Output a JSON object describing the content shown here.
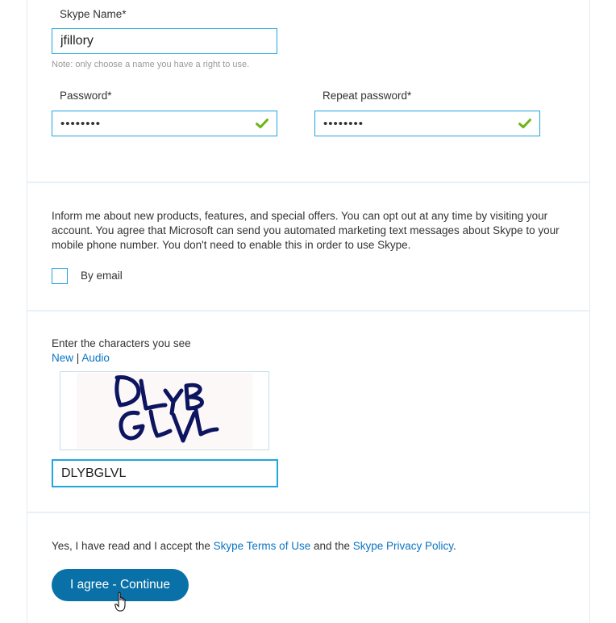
{
  "account": {
    "skype_name_label": "Skype Name*",
    "skype_name_value": "jfillory",
    "skype_name_note": "Note: only choose a name you have a right to use.",
    "password_label": "Password*",
    "password_value": "••••••••",
    "repeat_password_label": "Repeat password*",
    "repeat_password_value": "••••••••",
    "valid_icon": "checkmark-icon",
    "valid_color": "#6bb516"
  },
  "marketing": {
    "text": "Inform me about new products, features, and special offers. You can opt out at any time by visiting your account. You agree that Microsoft can send you automated marketing text messages about Skype to your mobile phone number. You don't need to enable this in order to use Skype.",
    "by_email_label": "By email",
    "by_email_checked": false
  },
  "captcha": {
    "prompt": "Enter the characters you see",
    "new_link": "New",
    "separator": "|",
    "audio_link": "Audio",
    "image_text": "DLYBGLVL",
    "input_value": "DLYBGLVL"
  },
  "terms": {
    "prefix": "Yes, I have read and I accept the ",
    "terms_link": "Skype Terms of Use",
    "middle": " and the ",
    "privacy_link": "Skype Privacy Policy",
    "suffix": "."
  },
  "submit": {
    "label": "I agree - Continue"
  },
  "colors": {
    "accent": "#1fa6de",
    "button": "#0a71a8",
    "link": "#0a74c2"
  }
}
